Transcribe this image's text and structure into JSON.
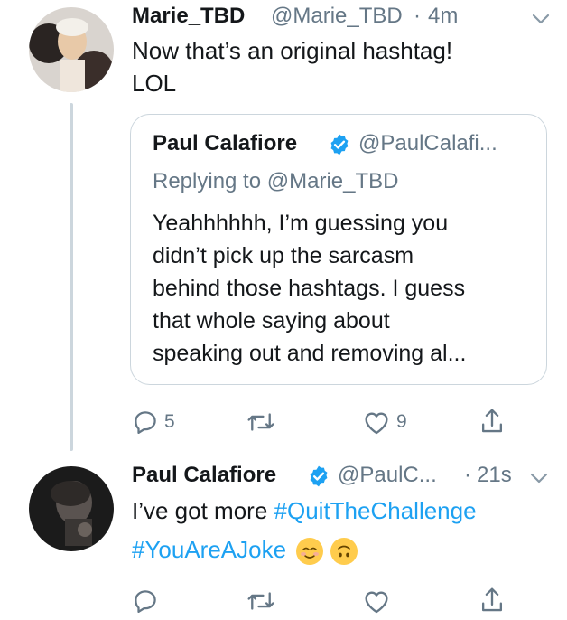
{
  "tweet1": {
    "name": "Marie_TBD",
    "handle": "@Marie_TBD",
    "dot": "·",
    "time": "4m",
    "text_line1": "Now that’s an original hashtag!",
    "text_line2": "LOL"
  },
  "quote": {
    "name": "Paul Calafiore",
    "handle": "@PaulCalafi...",
    "replying_prefix": "Replying to",
    "replying_handle": "@Marie_TBD",
    "lines": [
      "Yeahhhhhh, I’m guessing you",
      "didn’t pick up the sarcasm",
      "behind those hashtags. I guess",
      "that whole saying about",
      "speaking out and removing al..."
    ]
  },
  "tweet1_actions": {
    "reply_count": "5",
    "retweet_count": "",
    "like_count": "9"
  },
  "tweet2": {
    "name": "Paul Calafiore",
    "handle": "@PaulC...",
    "dot": "·",
    "time": "21s",
    "text_prefix": "I’ve got more",
    "hashtag1": "#QuitTheChallenge",
    "hashtag2": "#YouAreAJoke",
    "emojis": [
      "relieved-face",
      "upside-down-face"
    ]
  },
  "colors": {
    "link": "#1da1f2",
    "muted": "#657786",
    "border": "#ccd6dd",
    "verified": "#1da1f2"
  },
  "icons": [
    "chevron-down-icon",
    "verified-badge-icon",
    "reply-icon",
    "retweet-icon",
    "like-icon",
    "share-icon"
  ]
}
